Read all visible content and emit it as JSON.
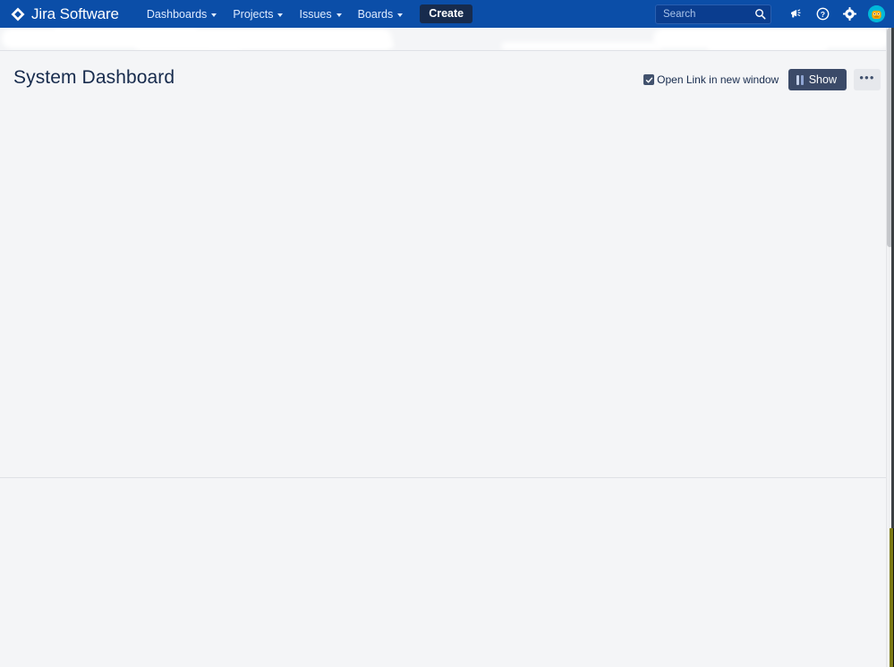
{
  "navbar": {
    "logo_text": "Jira Software",
    "logo_icon": "jira-diamond-logo",
    "items": [
      {
        "label": "Dashboards",
        "icon": "chevron-down-icon"
      },
      {
        "label": "Projects",
        "icon": "chevron-down-icon"
      },
      {
        "label": "Issues",
        "icon": "chevron-down-icon"
      },
      {
        "label": "Boards",
        "icon": "chevron-down-icon"
      }
    ],
    "create_label": "Create",
    "search": {
      "placeholder": "Search",
      "value": "",
      "icon": "search-icon"
    },
    "right_icons": [
      {
        "name": "megaphone-announcements-icon"
      },
      {
        "name": "help-question-icon"
      },
      {
        "name": "settings-gear-icon"
      }
    ],
    "avatar": {
      "name": "user-avatar",
      "background_color": "#00b8d9",
      "face_color": "#ffab00"
    }
  },
  "page": {
    "title": "System Dashboard",
    "open_link_checkbox": {
      "label": "Open Link in new window",
      "checked": true
    },
    "show_button": {
      "label": "Show",
      "icon": "columns-layout-icon"
    },
    "more_button": {
      "label": "•••",
      "icon": "more-actions-icon"
    }
  },
  "colors": {
    "nav_background": "#0b4ea8",
    "create_button": "#172b4d",
    "page_background": "#f4f5f7",
    "text_primary": "#172b4d",
    "divider": "#dfe1e6",
    "show_button": "#3b4a68"
  }
}
